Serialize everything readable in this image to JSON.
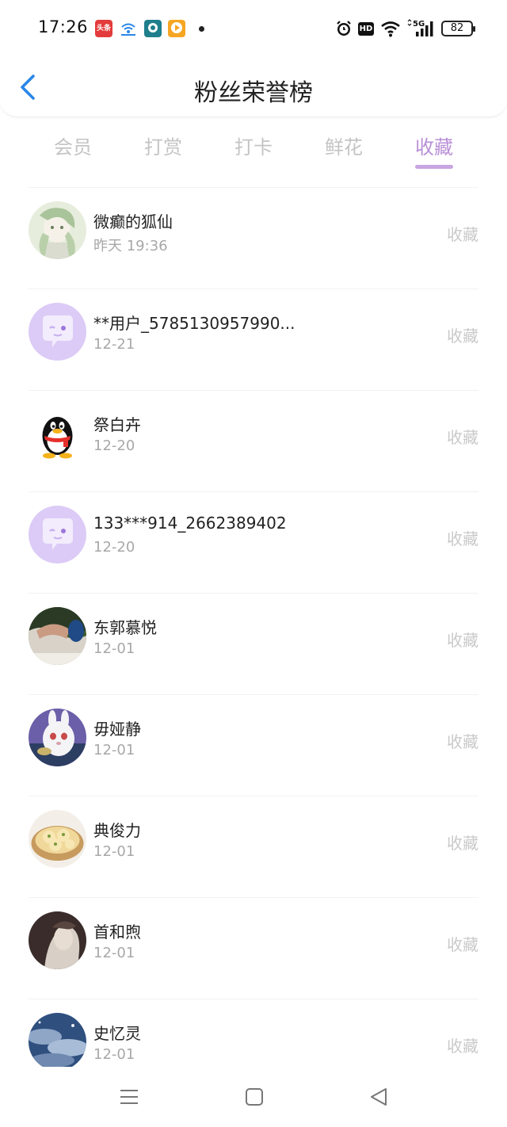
{
  "status_bar": {
    "time": "17:26",
    "app_icons": [
      "toutiao-icon",
      "wifi-app-icon",
      "teal-app-icon",
      "video-app-icon"
    ],
    "toutiao_label": "头条",
    "hd_label": "HD",
    "network_label": "5G",
    "battery": "82"
  },
  "header": {
    "title": "粉丝荣誉榜",
    "back_icon": "chevron-left-icon",
    "accent_color": "#2a86e8"
  },
  "tabs": [
    {
      "label": "会员"
    },
    {
      "label": "打赏"
    },
    {
      "label": "打卡"
    },
    {
      "label": "鲜花"
    },
    {
      "label": "收藏"
    }
  ],
  "active_tab": "收藏",
  "active_color": "#b98fd6",
  "fans": [
    {
      "name": "微癫的狐仙",
      "date": "昨天 19:36",
      "action": "收藏",
      "avatar": "anime-girl-avatar"
    },
    {
      "name": "**用户_5785130957990...",
      "date": "12-21",
      "action": "收藏",
      "avatar": "default-chat-avatar"
    },
    {
      "name": "祭白卉",
      "date": "12-20",
      "action": "收藏",
      "avatar": "qq-penguin-avatar"
    },
    {
      "name": "133***914_2662389402",
      "date": "12-20",
      "action": "收藏",
      "avatar": "default-chat-avatar"
    },
    {
      "name": "东郭慕悦",
      "date": "12-01",
      "action": "收藏",
      "avatar": "photo-avatar"
    },
    {
      "name": "毋娅静",
      "date": "12-01",
      "action": "收藏",
      "avatar": "bunny-avatar"
    },
    {
      "name": "典俊力",
      "date": "12-01",
      "action": "收藏",
      "avatar": "dumplings-avatar"
    },
    {
      "name": "首和煦",
      "date": "12-01",
      "action": "收藏",
      "avatar": "photo-avatar"
    },
    {
      "name": "史忆灵",
      "date": "12-01",
      "action": "收藏",
      "avatar": "sky-avatar"
    }
  ],
  "nav": [
    "menu-icon",
    "home-square-icon",
    "back-triangle-icon"
  ]
}
